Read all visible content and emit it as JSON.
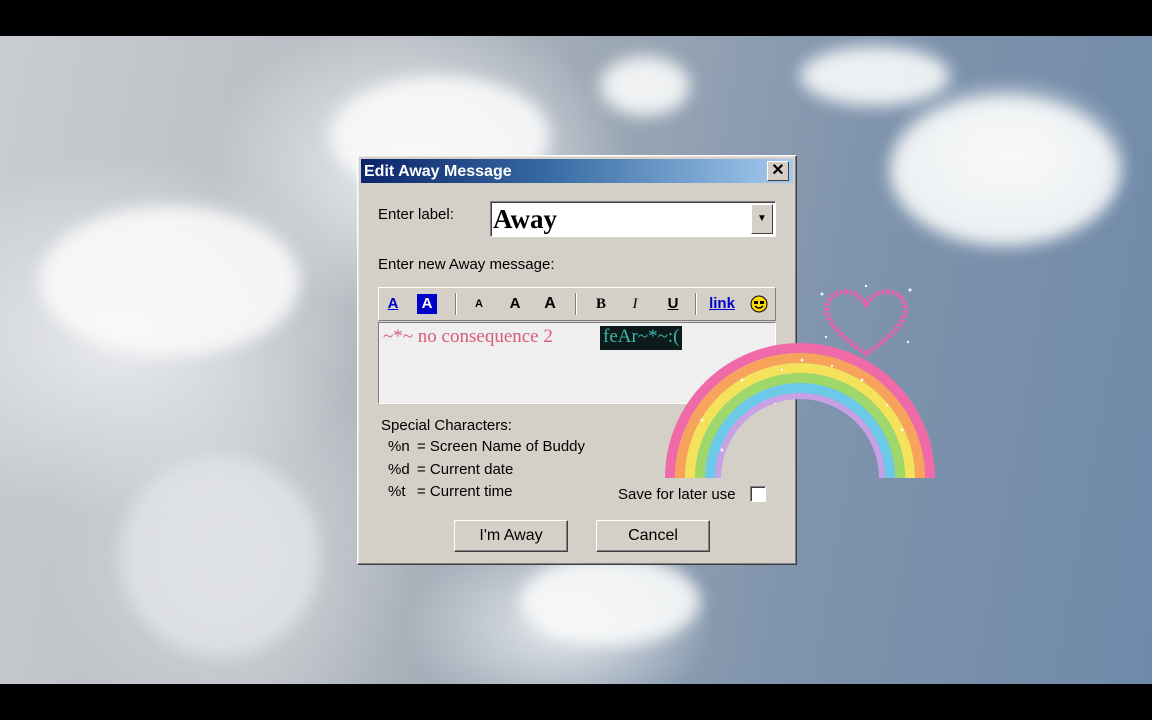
{
  "dialog": {
    "title": "Edit Away Message",
    "close_glyph": "✕",
    "label_prompt": "Enter label:",
    "label_value": "Away",
    "message_prompt": "Enter new Away message:",
    "toolbar": {
      "text_color": "A",
      "bg_color": "A",
      "font_smaller": "A",
      "font_normal": "A",
      "font_larger": "A",
      "bold": "B",
      "italic": "I",
      "underline": "U",
      "link": "link"
    },
    "message_text": "~*~ no consequence 2 ",
    "message_selected": "feAr~*~:(",
    "special_chars": {
      "heading": "Special Characters:",
      "items": [
        {
          "code": "%n",
          "desc": "= Screen Name of Buddy"
        },
        {
          "code": "%d",
          "desc": "= Current date"
        },
        {
          "code": "%t",
          "desc": "= Current time"
        }
      ]
    },
    "save_label": "Save for later use",
    "im_away_button": "I'm Away",
    "cancel_button": "Cancel"
  },
  "colors": {
    "title_bar_start": "#0a246a",
    "message_text": "#d85b77",
    "selected_text": "#3cb7a9",
    "link_color": "#0000cc"
  }
}
